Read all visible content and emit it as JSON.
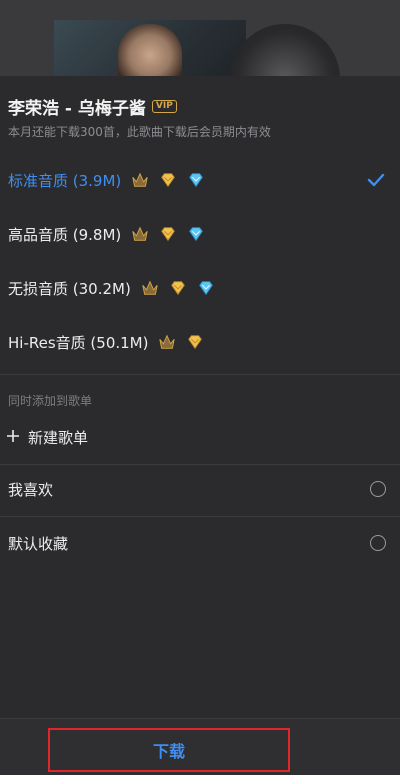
{
  "song": {
    "title": "李荣浩 - 乌梅子酱",
    "vip_label": "VIP",
    "note": "本月还能下载300首，此歌曲下载后会员期内有效"
  },
  "qualities": [
    {
      "label": "标准音质 (3.9M)",
      "selected": true,
      "badges": [
        "gold-crown-icon",
        "gold-diamond-icon",
        "blue-diamond-icon"
      ]
    },
    {
      "label": "高品音质 (9.8M)",
      "selected": false,
      "badges": [
        "gold-crown-icon",
        "gold-diamond-icon",
        "blue-diamond-icon"
      ]
    },
    {
      "label": "无损音质 (30.2M)",
      "selected": false,
      "badges": [
        "gold-crown-icon",
        "gold-diamond-icon",
        "blue-diamond-icon"
      ]
    },
    {
      "label": "Hi-Res音质 (50.1M)",
      "selected": false,
      "badges": [
        "gold-crown-icon",
        "gold-diamond-icon"
      ]
    }
  ],
  "playlist_section": {
    "header": "同时添加到歌单",
    "new_playlist_label": "新建歌单",
    "playlists": [
      {
        "label": "我喜欢"
      },
      {
        "label": "默认收藏"
      }
    ]
  },
  "footer": {
    "download_label": "下载"
  },
  "colors": {
    "accent": "#3f8ef0",
    "background": "#2b2b2d",
    "highlight_border": "#e0262b",
    "gold": "#d4a84a"
  }
}
